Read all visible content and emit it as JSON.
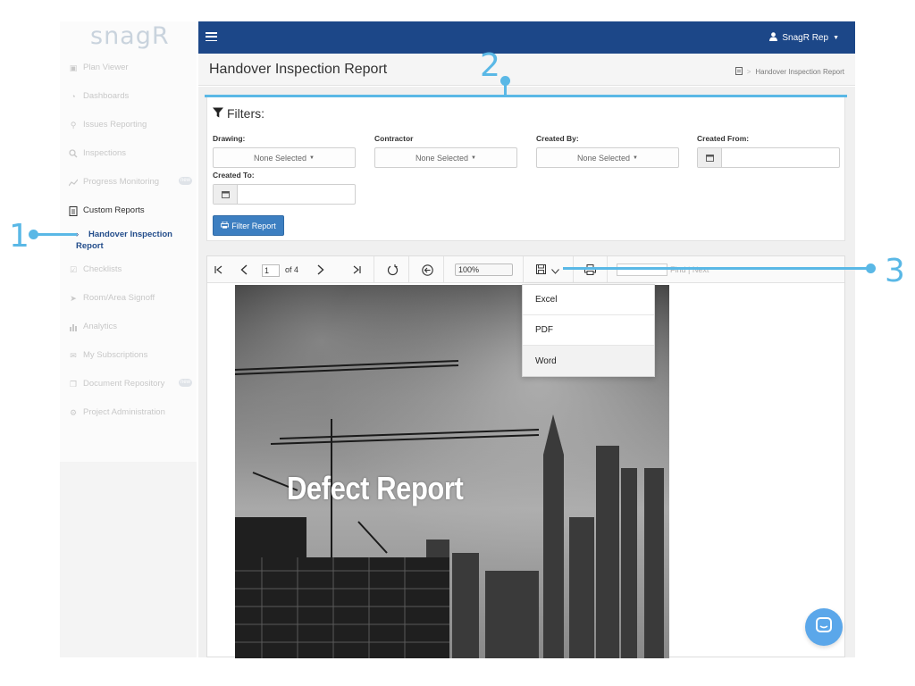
{
  "app": {
    "logo": "snagR",
    "user_menu": "SnagR Rep"
  },
  "sidebar": {
    "items": [
      {
        "label": "Plan Viewer",
        "icon": "image-icon"
      },
      {
        "label": "Dashboards",
        "icon": "dashboard-icon"
      },
      {
        "label": "Issues Reporting",
        "icon": "map-marker-icon"
      },
      {
        "label": "Inspections",
        "icon": "search-icon"
      },
      {
        "label": "Progress Monitoring",
        "icon": "line-chart-icon",
        "badge": "new"
      },
      {
        "label": "Custom Reports",
        "icon": "file-icon"
      },
      {
        "label": "Checklists",
        "icon": "checkbox-icon"
      },
      {
        "label": "Room/Area Signoff",
        "icon": "send-icon"
      },
      {
        "label": "Analytics",
        "icon": "bar-chart-icon"
      },
      {
        "label": "My Subscriptions",
        "icon": "envelope-icon"
      },
      {
        "label": "Document Repository",
        "icon": "copy-icon",
        "badge": "new"
      },
      {
        "label": "Project Administration",
        "icon": "cogs-icon"
      }
    ],
    "sub_item": "Handover Inspection Report"
  },
  "page": {
    "title": "Handover Inspection Report",
    "breadcrumb": "Handover Inspection Report"
  },
  "filters": {
    "title": "Filters:",
    "drawing_label": "Drawing:",
    "contractor_label": "Contractor",
    "created_by_label": "Created By:",
    "created_from_label": "Created From:",
    "created_to_label": "Created To:",
    "drawing_value": "None Selected",
    "contractor_value": "None Selected",
    "created_by_value": "None Selected",
    "filter_button": "Filter Report"
  },
  "viewer": {
    "page_value": "1",
    "page_of": "of 4",
    "zoom": "100%",
    "find_label": "Find",
    "next_label": "Next",
    "export_options": [
      "Excel",
      "PDF",
      "Word"
    ],
    "highlighted_export": "Word",
    "cover_title": "Defect Report"
  },
  "callouts": [
    "1",
    "2",
    "3"
  ],
  "colors": {
    "topbar": "#1c4788",
    "accent": "#3d7fc1",
    "callout": "#5ab8e6",
    "chat": "#5ba7ea"
  }
}
